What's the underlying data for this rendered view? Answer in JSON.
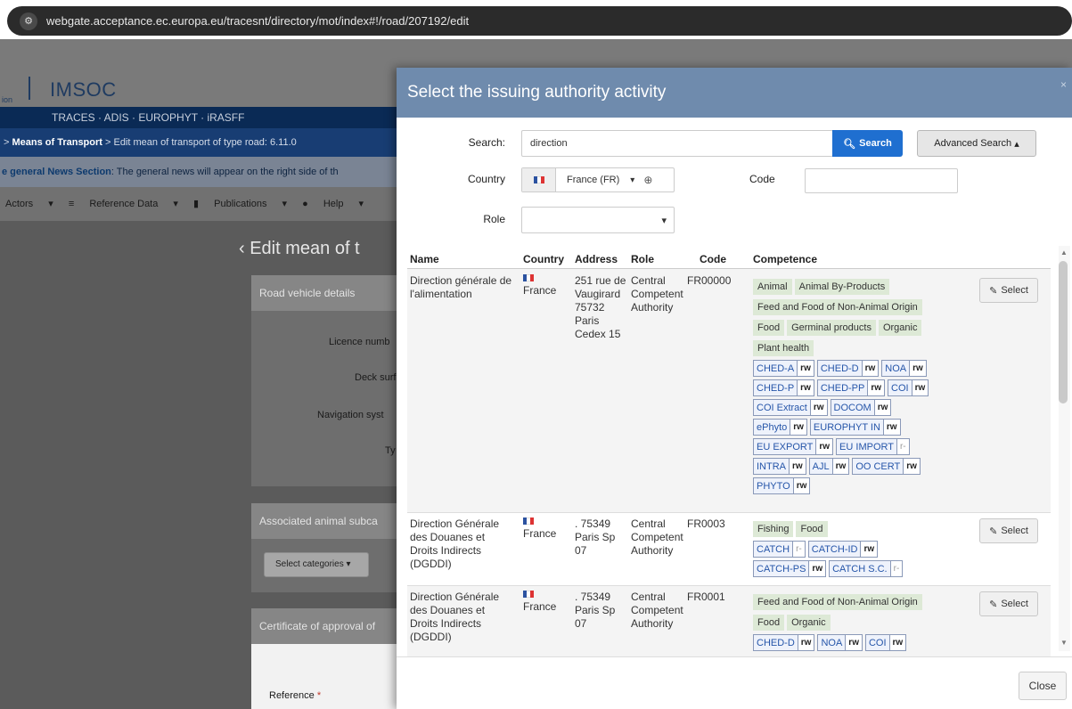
{
  "browser": {
    "url": "webgate.acceptance.ec.europa.eu/tracesnt/directory/mot/index#!/road/207192/edit"
  },
  "header": {
    "logo_fragment": "ion",
    "app_name": "IMSOC",
    "apps": "TRACES · ADIS · EUROPHYT · iRASFF"
  },
  "breadcrumb": {
    "parent": "Means of Transport",
    "current": "Edit mean of transport of type road: 6.11.0"
  },
  "news": {
    "label": "e general News Section",
    "text": ": The general news will appear on the right side of th"
  },
  "menu": {
    "actors": "Actors",
    "reference_data": "Reference Data",
    "publications": "Publications",
    "help": "Help"
  },
  "page": {
    "heading": "Edit mean of t"
  },
  "panels": {
    "road_vehicle": "Road vehicle details",
    "licence": "Licence numb",
    "deck": "Deck surfa",
    "navigation": "Navigation syst",
    "type": "Ty",
    "animal_subcat": "Associated animal subca",
    "select_categories": "Select categories",
    "certificate": "Certificate of approval of",
    "reference": "Reference"
  },
  "modal": {
    "title": "Select the issuing authority activity",
    "close_x": "×",
    "search_label": "Search:",
    "search_value": "direction",
    "search_button": "Search",
    "advanced_button": "Advanced Search",
    "country_label": "Country",
    "country_value": "France (FR)",
    "code_label": "Code",
    "role_label": "Role",
    "columns": [
      "Name",
      "Country",
      "Address",
      "Role",
      "Code",
      "Competence"
    ],
    "close_button": "Close",
    "select_label": "Select",
    "rows": [
      {
        "name": "Direction générale de l'alimentation",
        "country": "France",
        "address": "251 rue de Vaugirard 75732 Paris Cedex 15",
        "role": "Central Competent Authority",
        "code": "FR00000",
        "tags": [
          "Animal",
          "Animal By-Products",
          "Feed and Food of Non-Animal Origin",
          "Food",
          "Germinal products",
          "Organic",
          "Plant health"
        ],
        "perms": [
          [
            "CHED-A",
            "rw"
          ],
          [
            "CHED-D",
            "rw"
          ],
          [
            "NOA",
            "rw"
          ],
          [
            "CHED-P",
            "rw"
          ],
          [
            "CHED-PP",
            "rw"
          ],
          [
            "COI",
            "rw"
          ],
          [
            "COI Extract",
            "rw"
          ],
          [
            "DOCOM",
            "rw"
          ],
          [
            "ePhyto",
            "rw"
          ],
          [
            "EUROPHYT IN",
            "rw"
          ],
          [
            "EU EXPORT",
            "rw"
          ],
          [
            "EU IMPORT",
            "r-"
          ],
          [
            "INTRA",
            "rw"
          ],
          [
            "AJL",
            "rw"
          ],
          [
            "OO CERT",
            "rw"
          ],
          [
            "PHYTO",
            "rw"
          ]
        ]
      },
      {
        "name": "Direction Générale des Douanes et Droits Indirects (DGDDI)",
        "country": "France",
        "address": ". 75349 Paris Sp 07",
        "role": "Central Competent Authority",
        "code": "FR0003",
        "tags": [
          "Fishing",
          "Food"
        ],
        "perms": [
          [
            "CATCH",
            "r-"
          ],
          [
            "CATCH-ID",
            "rw"
          ],
          [
            "CATCH-PS",
            "rw"
          ],
          [
            "CATCH S.C.",
            "r-"
          ]
        ]
      },
      {
        "name": "Direction Générale des Douanes et Droits Indirects (DGDDI)",
        "country": "France",
        "address": ". 75349 Paris Sp 07",
        "role": "Central Competent Authority",
        "code": "FR0001",
        "tags": [
          "Feed and Food of Non-Animal Origin",
          "Food",
          "Organic"
        ],
        "perms": [
          [
            "CHED-D",
            "rw"
          ],
          [
            "NOA",
            "rw"
          ],
          [
            "COI",
            "rw"
          ]
        ]
      }
    ]
  }
}
